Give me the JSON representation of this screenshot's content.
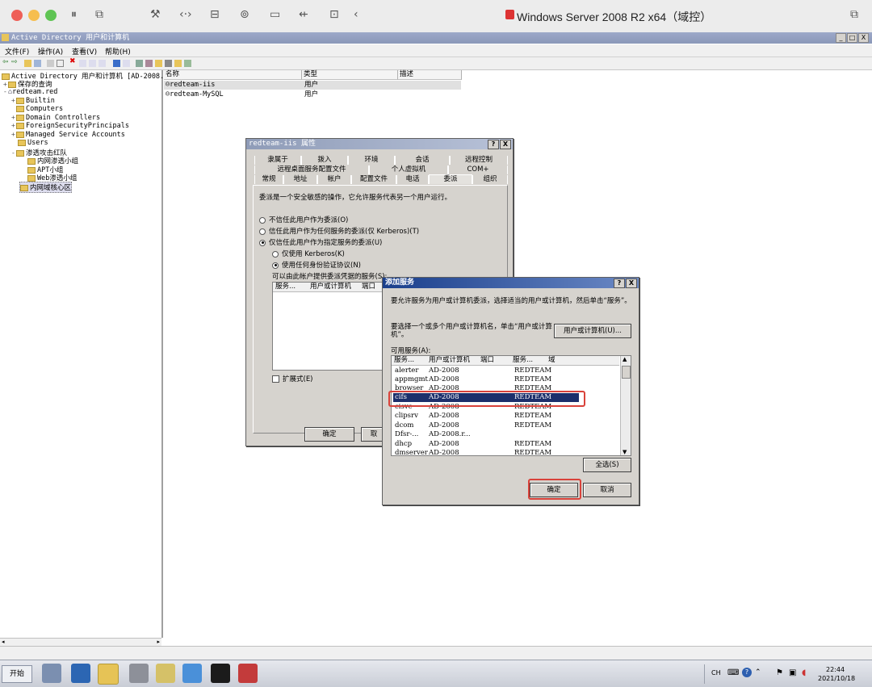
{
  "mac": {
    "title": "Windows Server 2008 R2 x64（域控）",
    "colors": {
      "close": "#ee5f57",
      "min": "#f6be4f",
      "max": "#5fc454"
    },
    "icons": [
      "sidebar-icon",
      "screenshot-icon",
      "wrench-icon",
      "code-icon",
      "drive-icon",
      "user-icon",
      "camera-icon",
      "usb-icon",
      "folder-share-icon",
      "back-arrow-icon",
      "windows-icon",
      "copy-icon"
    ]
  },
  "app": {
    "title": "Active Directory 用户和计算机",
    "menu": [
      "文件(F)",
      "操作(A)",
      "查看(V)",
      "帮助(H)"
    ],
    "window_buttons": [
      "_",
      "□",
      "X"
    ]
  },
  "tree": {
    "root": "Active Directory 用户和计算机 [AD-2008.",
    "items": [
      {
        "label": "保存的查询",
        "level": 1,
        "expander": "+"
      },
      {
        "label": "redteam.red",
        "level": 1,
        "expander": "-"
      },
      {
        "label": "Builtin",
        "level": 2,
        "expander": "+"
      },
      {
        "label": "Computers",
        "level": 2,
        "expander": ""
      },
      {
        "label": "Domain Controllers",
        "level": 2,
        "expander": "+"
      },
      {
        "label": "ForeignSecurityPrincipals",
        "level": 2,
        "expander": "+"
      },
      {
        "label": "Managed Service Accounts",
        "level": 2,
        "expander": "+"
      },
      {
        "label": "Users",
        "level": 2,
        "expander": ""
      },
      {
        "label": "渗透攻击红队",
        "level": 2,
        "expander": "-"
      },
      {
        "label": "内网渗透小组",
        "level": 3,
        "expander": ""
      },
      {
        "label": "APT小组",
        "level": 3,
        "expander": ""
      },
      {
        "label": "Web渗透小组",
        "level": 3,
        "expander": ""
      },
      {
        "label": "内网域核心区",
        "level": 2,
        "expander": "",
        "selected": true
      }
    ]
  },
  "list": {
    "columns": [
      "名称",
      "类型",
      "描述"
    ],
    "rows": [
      {
        "name": "redteam-iis",
        "type": "用户",
        "selected": true
      },
      {
        "name": "redteam-MySQL",
        "type": "用户"
      }
    ]
  },
  "props": {
    "title": "redteam-iis 属性",
    "tabs_row1": [
      "隶属于",
      "拨入",
      "环境",
      "会话",
      "远程控制"
    ],
    "tabs_row2": [
      "远程桌面服务配置文件",
      "个人虚拟机",
      "COM+"
    ],
    "tabs_row3": [
      "常规",
      "地址",
      "帐户",
      "配置文件",
      "电话",
      "委派",
      "组织"
    ],
    "desc": "委派是一个安全敏感的操作，它允许服务代表另一个用户运行。",
    "opt1": "不信任此用户作为委派(O)",
    "opt2": "信任此用户作为任何服务的委派(仅 Kerberos)(T)",
    "opt3": "仅信任此用户作为指定服务的委派(U)",
    "sub1": "仅使用 Kerberos(K)",
    "sub2": "使用任何身份验证协议(N)",
    "svc_label": "可以由此帐户提供委派凭据的服务(S):",
    "svc_cols": [
      "服务...",
      "用户或计算机",
      "端口"
    ],
    "expand": "扩展式(E)",
    "ok": "确定",
    "cancel": "取"
  },
  "add": {
    "title": "添加服务",
    "desc": "要允许服务为用户或计算机委派，选择适当的用户或计算机，然后单击“服务”。",
    "select_hint": "要选择一个或多个用户或计算机名，单击“用户或计算机”。",
    "user_btn": "用户或计算机(U)...",
    "avail": "可用服务(A):",
    "cols": [
      "服务...",
      "用户或计算机",
      "端口",
      "服务...",
      "域"
    ],
    "rows": [
      {
        "svc": "alerter",
        "host": "AD-2008",
        "domain": "REDTEAM"
      },
      {
        "svc": "appmgmt",
        "host": "AD-2008",
        "domain": "REDTEAM"
      },
      {
        "svc": "browser",
        "host": "AD-2008",
        "domain": "REDTEAM"
      },
      {
        "svc": "cifs",
        "host": "AD-2008",
        "domain": "REDTEAM",
        "selected": true
      },
      {
        "svc": "cisvc",
        "host": "AD-2008",
        "domain": "REDTEAM"
      },
      {
        "svc": "clipsrv",
        "host": "AD-2008",
        "domain": "REDTEAM"
      },
      {
        "svc": "dcom",
        "host": "AD-2008",
        "domain": "REDTEAM"
      },
      {
        "svc": "Dfsr-...",
        "host": "AD-2008.r...",
        "domain": ""
      },
      {
        "svc": "dhcp",
        "host": "AD-2008",
        "domain": "REDTEAM"
      },
      {
        "svc": "dmserver",
        "host": "AD-2008",
        "domain": "REDTEAM"
      }
    ],
    "select_all": "全选(S)",
    "ok": "确定",
    "cancel": "取消"
  },
  "taskbar": {
    "start": "开始",
    "lang": "CH",
    "time": "22:44",
    "date": "2021/10/18"
  }
}
